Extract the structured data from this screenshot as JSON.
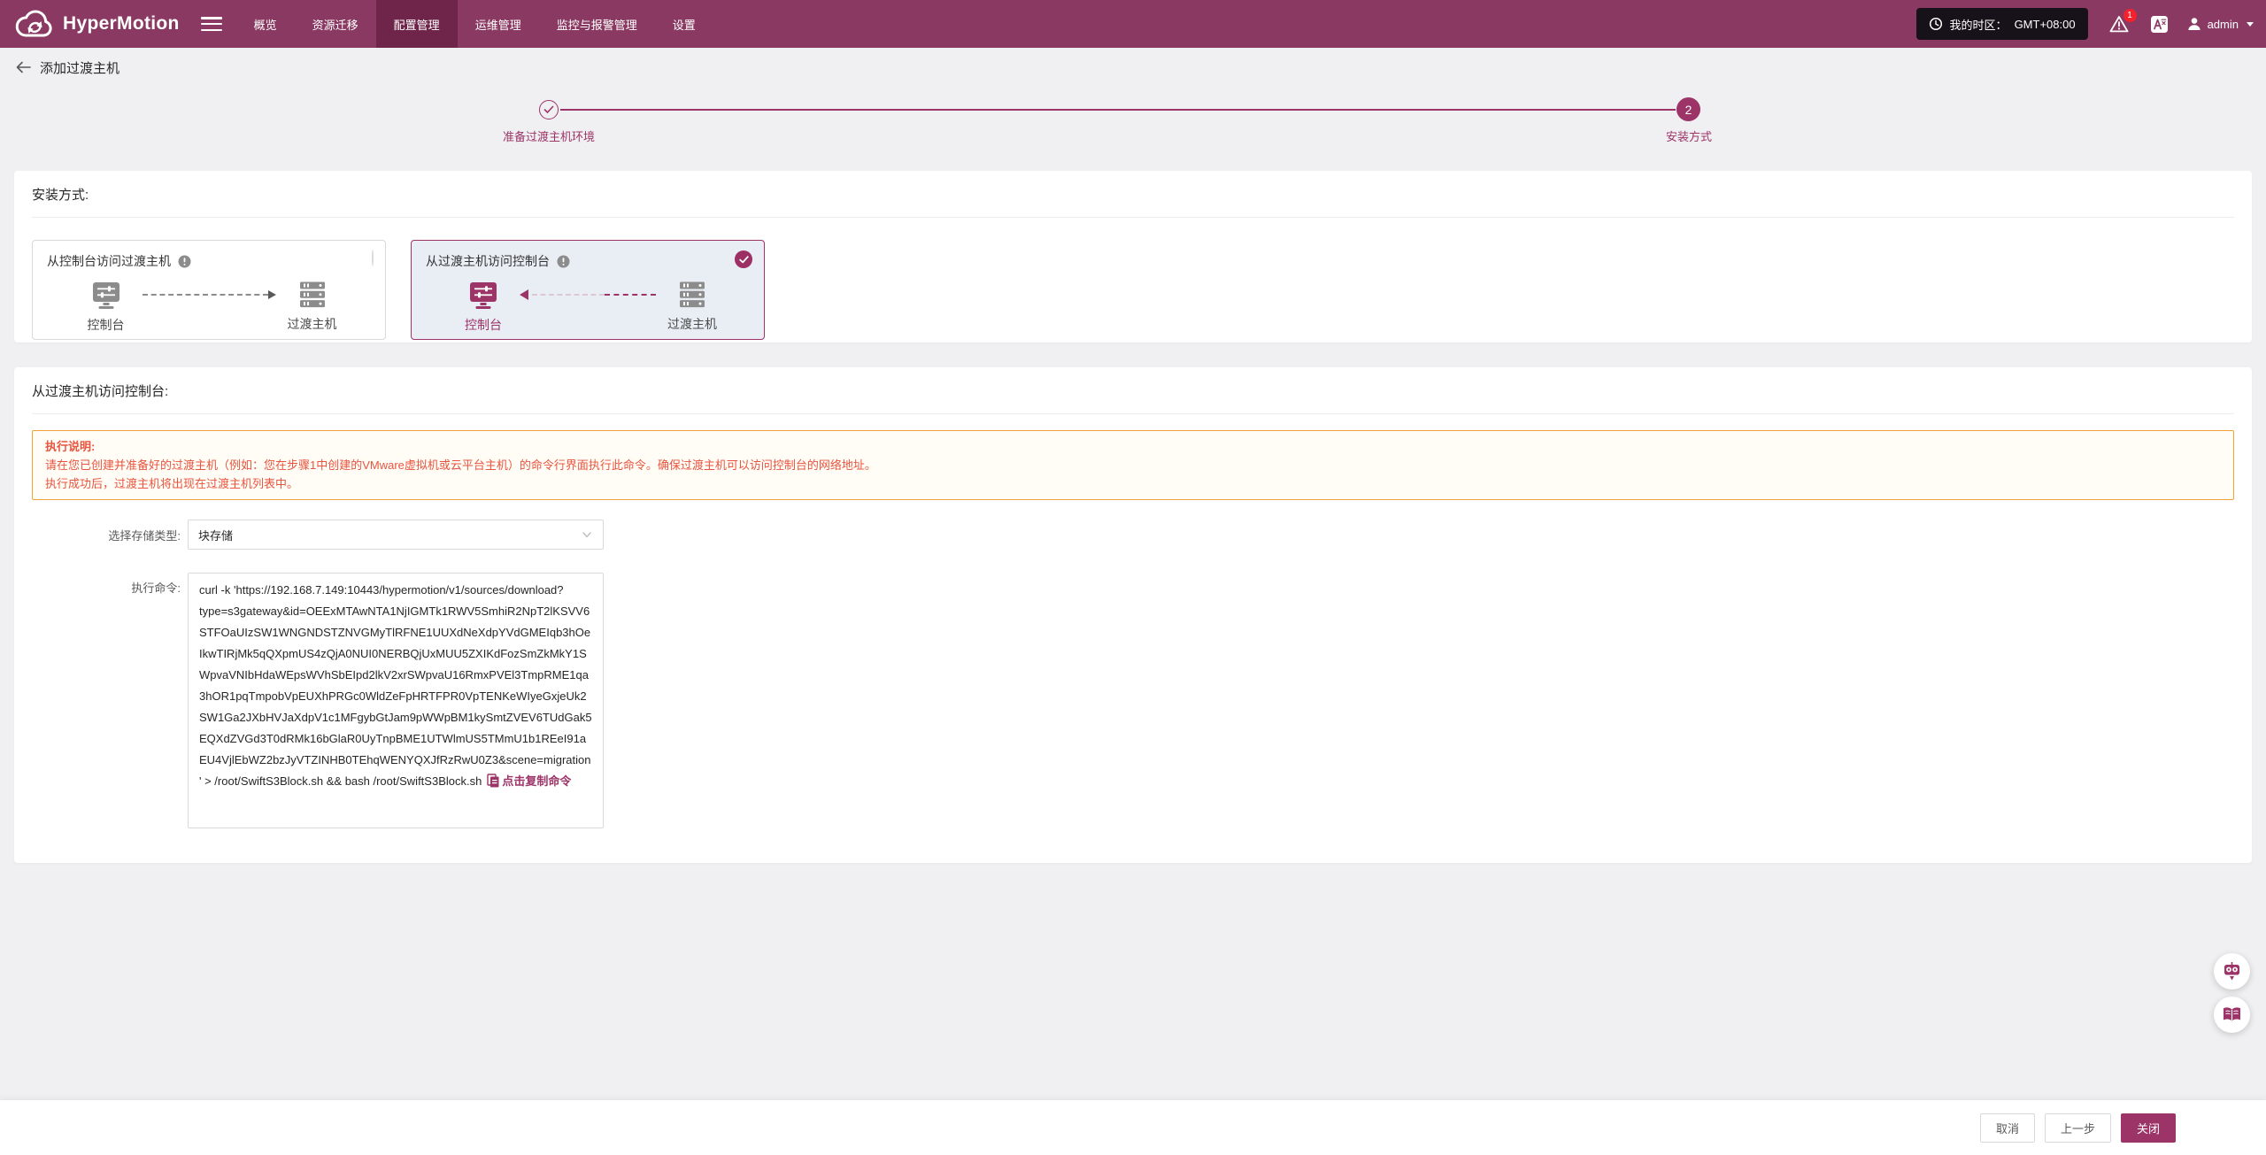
{
  "colors": {
    "navbar_bg": "#8a3a62",
    "navbar_active_bg": "#6f2449",
    "primary": "#9c3468",
    "page_bg": "#f0f0f2",
    "selected_card_bg": "#e9eef5",
    "notice_border": "#efa13c",
    "notice_bg": "#fffdf6",
    "notice_text": "#e8543f",
    "badge_red": "#f5222d"
  },
  "navbar": {
    "brand": "HyperMotion",
    "items": [
      {
        "label": "概览"
      },
      {
        "label": "资源迁移"
      },
      {
        "label": "配置管理"
      },
      {
        "label": "运维管理"
      },
      {
        "label": "监控与报警管理"
      },
      {
        "label": "设置"
      }
    ],
    "active_item": "配置管理",
    "timezone_label": "我的时区：",
    "timezone_value": "GMT+08:00",
    "alert_count": "1",
    "username": "admin"
  },
  "page": {
    "title": "添加过渡主机"
  },
  "stepper": {
    "step1": {
      "label": "准备过渡主机环境",
      "state": "completed"
    },
    "step2": {
      "label": "安装方式",
      "number": "2",
      "state": "active"
    }
  },
  "install": {
    "section_title": "安装方式:",
    "option1": {
      "title": "从控制台访问过渡主机",
      "from_label": "控制台",
      "to_label": "过渡主机",
      "selected": false
    },
    "option2": {
      "title": "从过渡主机访问控制台",
      "from_label": "控制台",
      "to_label": "过渡主机",
      "selected": true
    }
  },
  "detail": {
    "section_title": "从过渡主机访问控制台:",
    "notice_title": "执行说明:",
    "notice_line1": "请在您已创建并准备好的过渡主机（例如：您在步骤1中创建的VMware虚拟机或云平台主机）的命令行界面执行此命令。确保过渡主机可以访问控制台的网络地址。",
    "notice_line2": "执行成功后，过渡主机将出现在过渡主机列表中。",
    "storage_label": "选择存储类型:",
    "storage_value": "块存储",
    "command_label": "执行命令:",
    "command": "curl -k 'https://192.168.7.149:10443/hypermotion/v1/sources/download?type=s3gateway&id=OEExMTAwNTA1NjIGMTk1RWV5SmhiR2NpT2lKSVV6STFOaUIzSW1WNGNDSTZNVGMyTlRFNE1UUXdNeXdpYVdGMEIqb3hOeIkwTIRjMk5qQXpmUS4zQjA0NUI0NERBQjUxMUU5ZXIKdFozSmZkMkY1SWpvaVNIbHdaWEpsWVhSbEIpd2lkV2xrSWpvaU16RmxPVEl3TmpRME1qa3hOR1pqTmpobVpEUXhPRGc0WldZeFpHRTFPR0VpTENKeWIyeGxjeUk2SW1Ga2JXbHVJaXdpV1c1MFgybGtJam9pWWpBM1kySmtZVEV6TUdGak5EQXdZVGd3T0dRMk16bGlaR0UyTnpBME1UTWlmUS5TMmU1b1REeI91aEU4VjlEbWZ2bzJyVTZINHB0TEhqWENYQXJfRzRwU0Z3&scene=migration' > /root/SwiftS3Block.sh && bash /root/SwiftS3Block.sh",
    "copy_link": "点击复制命令"
  },
  "footer": {
    "cancel": "取消",
    "prev": "上一步",
    "close": "关闭"
  },
  "floating": {
    "assistant_icon": "robot-icon",
    "docs_icon": "open-book-icon"
  }
}
